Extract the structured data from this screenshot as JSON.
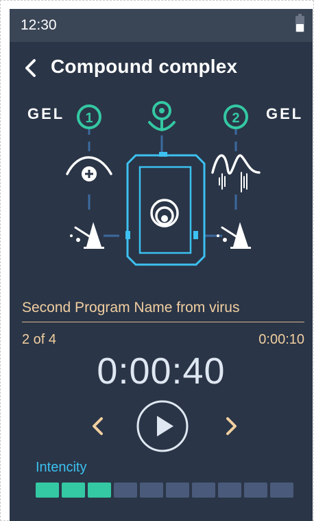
{
  "status": {
    "time": "12:30",
    "battery_icon": "battery-icon"
  },
  "header": {
    "title": "Compound complex",
    "back_icon": "chevron-left-icon"
  },
  "diagram": {
    "left_label": "GEL",
    "right_label": "GEL",
    "channel_1": "1",
    "channel_2": "2",
    "icons": {
      "top_center": "location-pin-icon",
      "left_wave": "wave-plus-icon",
      "right_wave": "sine-wave-icon",
      "left_metronome": "metronome-icon",
      "right_metronome": "metronome-icon",
      "device": "device-icon"
    }
  },
  "program": {
    "name": "Second Program Name from virus",
    "step": "2 of 4",
    "elapsed": "0:00:10",
    "remaining": "0:00:40"
  },
  "controls": {
    "prev_icon": "chevron-left-icon",
    "next_icon": "chevron-right-icon",
    "play_icon": "play-icon"
  },
  "intensity": {
    "label": "Intencity",
    "level": 3,
    "max": 10,
    "on_color": "#34c8a3",
    "off_color": "#4a5a7a"
  },
  "colors": {
    "background": "#2a3547",
    "accent_teal": "#34c8a3",
    "accent_blue": "#3cc1f0",
    "accent_gold": "#f2cfa0"
  }
}
